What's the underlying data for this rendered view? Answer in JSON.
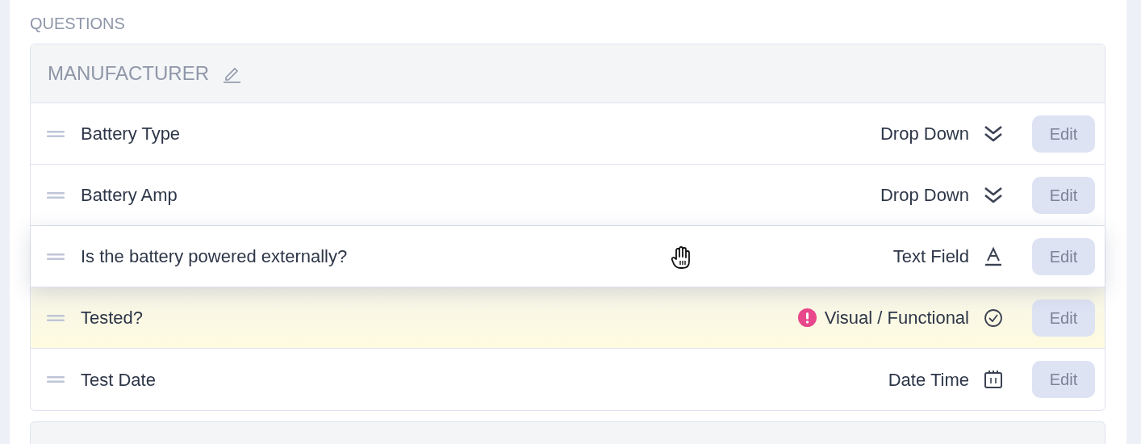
{
  "section_label": "QUESTIONS",
  "group": {
    "title": "MANUFACTURER",
    "editable": true,
    "questions": [
      {
        "label": "Battery Type",
        "type": "Drop Down",
        "kind": "chevrons",
        "dragging": false,
        "highlighted": false,
        "warning": false,
        "action": "Edit"
      },
      {
        "label": "Battery Amp",
        "type": "Drop Down",
        "kind": "chevrons",
        "dragging": false,
        "highlighted": false,
        "warning": false,
        "action": "Edit"
      },
      {
        "label": "Is the battery powered externally?",
        "type": "Text Field",
        "kind": "text",
        "dragging": true,
        "highlighted": false,
        "warning": false,
        "action": "Edit"
      },
      {
        "label": "Tested?",
        "type": "Visual / Functional",
        "kind": "check",
        "dragging": false,
        "highlighted": true,
        "warning": true,
        "action": "Edit"
      },
      {
        "label": "Test Date",
        "type": "Date Time",
        "kind": "calendar",
        "dragging": false,
        "highlighted": false,
        "warning": false,
        "action": "Edit"
      }
    ]
  }
}
